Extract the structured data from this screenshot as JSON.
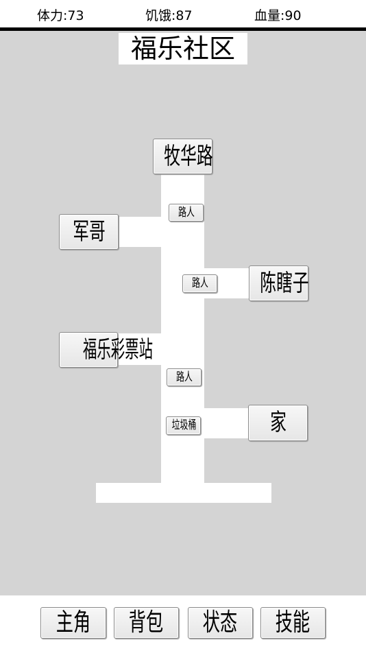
{
  "status": {
    "stamina": "体力:73",
    "hunger": "饥饿:87",
    "health": "血量:90"
  },
  "map": {
    "title": "福乐社区",
    "locations": {
      "muhua_road": "牧华路",
      "junge": "军哥",
      "chen_xiazi": "陈瞎子",
      "lottery_station": "福乐彩票站",
      "home": "家"
    },
    "npcs": {
      "passerby_1": "路人",
      "passerby_2": "路人",
      "passerby_3": "路人",
      "trash_can": "垃圾桶"
    }
  },
  "menu": {
    "protagonist": "主角",
    "backpack": "背包",
    "status": "状态",
    "skills": "技能"
  }
}
